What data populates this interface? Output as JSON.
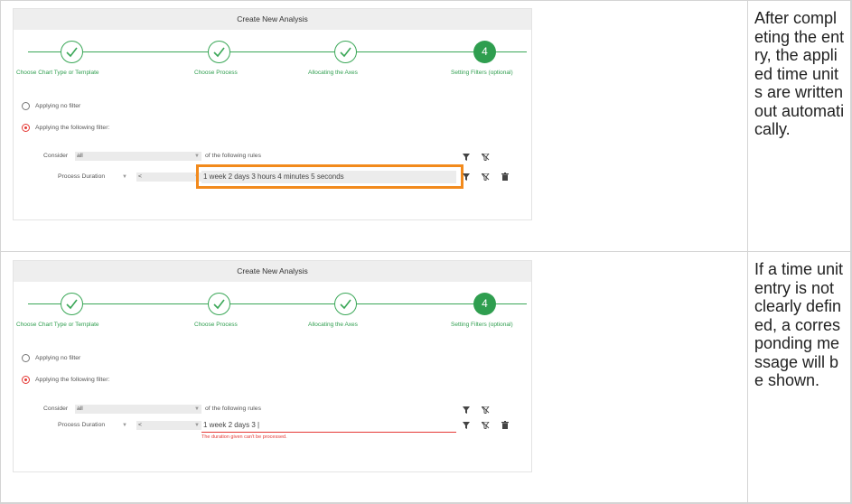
{
  "rows": [
    {
      "note": "After completing the entry, the applied time units are written out automatically.",
      "dialog": {
        "title": "Create New Analysis",
        "steps": [
          "Choose Chart Type or Template",
          "Choose Process",
          "Allocating the Axes",
          "Setting Filters (optional)"
        ],
        "active_step_number": "4",
        "option_no_filter": "Applying no filter",
        "option_filter": "Applying the following filter:",
        "consider_label": "Consider",
        "consider_value": "all",
        "rules_label": "of the following rules",
        "rule_field": "Process Duration",
        "rule_operator": "<",
        "rule_value": "1 week 2 days 3 hours 4 minutes 5 seconds",
        "error": ""
      }
    },
    {
      "note": "If a time unit entry is not clearly defined, a corresponding message will be shown.",
      "dialog": {
        "title": "Create New Analysis",
        "steps": [
          "Choose Chart Type or Template",
          "Choose Process",
          "Allocating the Axes",
          "Setting Filters (optional)"
        ],
        "active_step_number": "4",
        "option_no_filter": "Applying no filter",
        "option_filter": "Applying the following filter:",
        "consider_label": "Consider",
        "consider_value": "all",
        "rules_label": "of the following rules",
        "rule_field": "Process Duration",
        "rule_operator": "<",
        "rule_value": "1 week 2 days 3 |",
        "error": "The duration given can't be processed."
      }
    }
  ],
  "colors": {
    "accent_green": "#2f9e4f",
    "highlight_orange": "#f28a1c",
    "error_red": "#e53935"
  },
  "icons": [
    "check-icon",
    "filter-icon",
    "filter-clear-icon",
    "trash-icon",
    "caret-down-icon"
  ]
}
